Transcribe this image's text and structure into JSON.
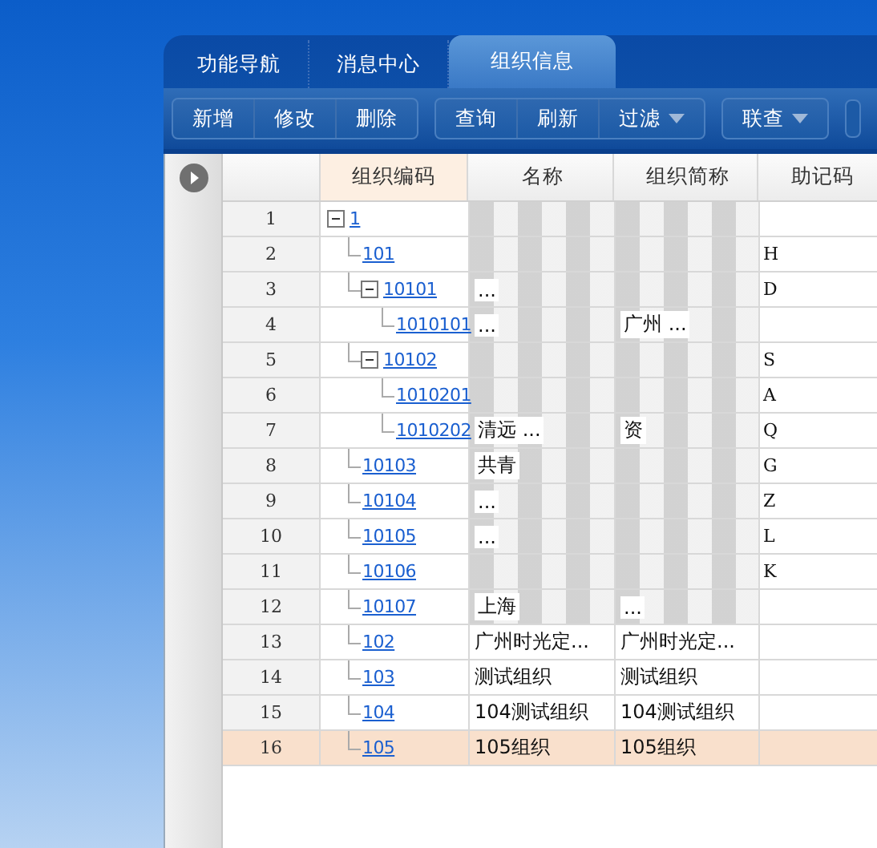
{
  "tabs": [
    {
      "label": "功能导航",
      "selected": false
    },
    {
      "label": "消息中心",
      "selected": false
    },
    {
      "label": "组织信息",
      "selected": true
    }
  ],
  "toolbar": [
    [
      "新增",
      "修改",
      "删除"
    ],
    [
      {
        "label": "查询"
      },
      {
        "label": "刷新"
      },
      {
        "label": "过滤",
        "dropdown": true
      }
    ],
    [
      {
        "label": "联查",
        "dropdown": true
      }
    ]
  ],
  "table": {
    "columns": [
      "组织编码",
      "名称",
      "组织简称",
      "助记码"
    ],
    "rows": [
      {
        "num": "1",
        "code": "1",
        "expanded": true,
        "name": {
          "masked": true
        },
        "short": {
          "masked": true
        },
        "selected": false,
        "children": [
          {
            "num": "2",
            "code": "101",
            "name": {
              "masked": true
            },
            "short": {
              "masked": true
            },
            "mnemonic": "H",
            "selected": false
          },
          {
            "num": "3",
            "code": "10101",
            "expanded": true,
            "name": {
              "text": "...",
              "masked": true
            },
            "short": {
              "masked": true
            },
            "mnemonic": "D",
            "selected": false,
            "children": [
              {
                "num": "4",
                "code": "1010101",
                "name": {
                  "text": "...",
                  "masked": true
                },
                "short": {
                  "text": "广州 ...",
                  "masked": true
                },
                "selected": false
              }
            ]
          },
          {
            "num": "5",
            "code": "10102",
            "expanded": true,
            "name": {
              "masked": true
            },
            "short": {
              "masked": true
            },
            "mnemonic": "S",
            "selected": false,
            "children": [
              {
                "num": "6",
                "code": "1010201",
                "name": {
                  "masked": true
                },
                "short": {
                  "masked": true
                },
                "mnemonic": "A",
                "selected": false
              },
              {
                "num": "7",
                "code": "1010202",
                "name": {
                  "text": "清远 ...",
                  "masked": true
                },
                "short": {
                  "text": "资",
                  "masked": true
                },
                "mnemonic": "Q",
                "selected": false
              }
            ]
          },
          {
            "num": "8",
            "code": "10103",
            "name": {
              "text": "共青",
              "masked": true
            },
            "short": {
              "masked": true
            },
            "mnemonic": "G",
            "selected": false
          },
          {
            "num": "9",
            "code": "10104",
            "name": {
              "text": "...",
              "masked": true
            },
            "short": {
              "masked": true
            },
            "mnemonic": "Z",
            "selected": false
          },
          {
            "num": "10",
            "code": "10105",
            "name": {
              "text": "...",
              "masked": true
            },
            "short": {
              "masked": true
            },
            "mnemonic": "L",
            "selected": false
          },
          {
            "num": "11",
            "code": "10106",
            "name": {
              "masked": true
            },
            "short": {
              "masked": true
            },
            "mnemonic": "K",
            "selected": false
          },
          {
            "num": "12",
            "code": "10107",
            "name": {
              "text": "上海",
              "masked": true
            },
            "short": {
              "text": "...",
              "masked": true
            },
            "selected": false
          },
          {
            "num": "13",
            "code": "102",
            "name": {
              "text": "广州时光定...",
              "masked": false
            },
            "short": {
              "text": "广州时光定...",
              "masked": false
            },
            "selected": false
          },
          {
            "num": "14",
            "code": "103",
            "name": {
              "text": "测试组织",
              "masked": false
            },
            "short": {
              "text": "测试组织",
              "masked": false
            },
            "selected": false
          },
          {
            "num": "15",
            "code": "104",
            "name": {
              "text": "104测试组织",
              "masked": false
            },
            "short": {
              "text": "104测试组织",
              "masked": false
            },
            "selected": false
          },
          {
            "num": "16",
            "code": "105",
            "name": {
              "text": "105组织",
              "masked": false
            },
            "short": {
              "text": "105组织",
              "masked": false
            },
            "selected": true
          }
        ]
      }
    ]
  }
}
